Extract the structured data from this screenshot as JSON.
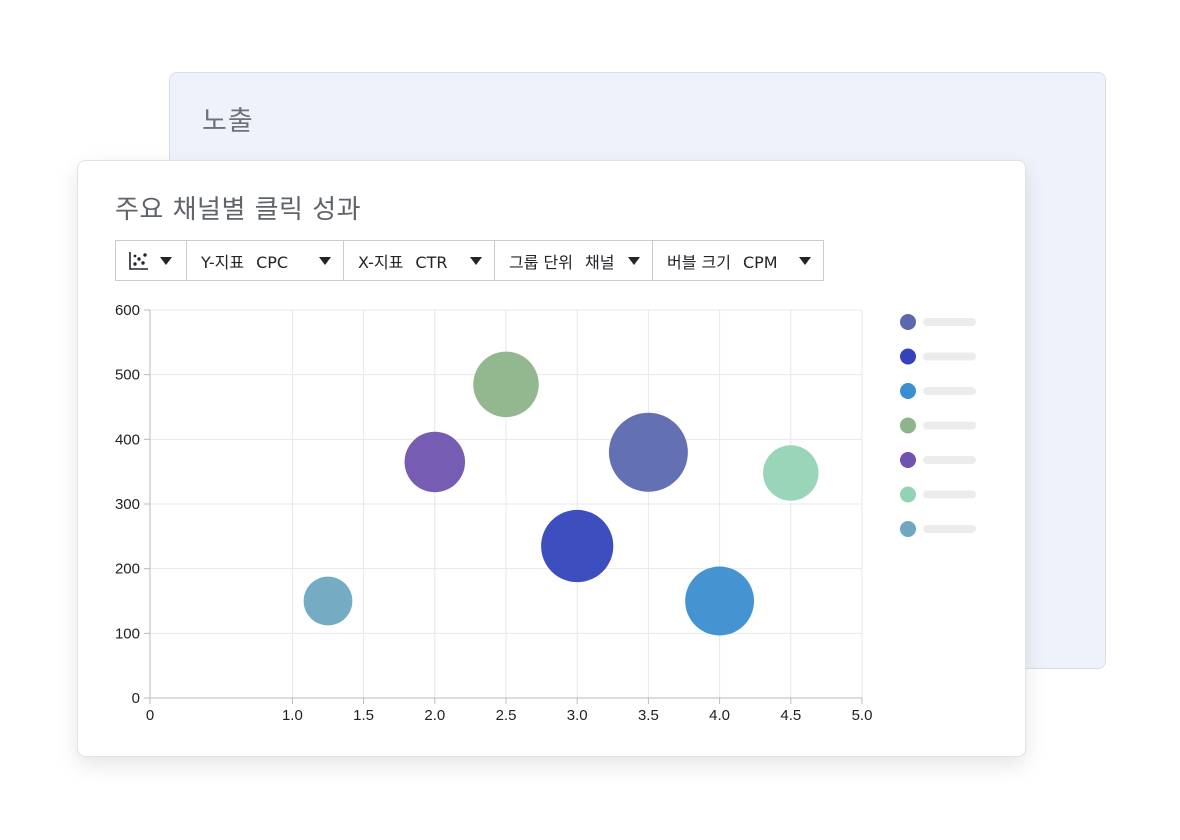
{
  "back_card": {
    "title": "노출"
  },
  "front_card": {
    "title": "주요 채널별 클릭 성과"
  },
  "toolbar": {
    "chart_type_icon": "scatter-chart-icon",
    "y_metric": {
      "label": "Y-지표",
      "value": "CPC"
    },
    "x_metric": {
      "label": "X-지표",
      "value": "CTR"
    },
    "group_unit": {
      "label": "그룹 단위",
      "value": "채널"
    },
    "bubble_size": {
      "label": "버블 크기",
      "value": "CPM"
    }
  },
  "chart_data": {
    "type": "scatter",
    "title": "",
    "xlabel": "",
    "ylabel": "",
    "xlim": [
      0,
      5.0
    ],
    "ylim": [
      0,
      600
    ],
    "x_ticks": [
      "0",
      "1.0",
      "1.5",
      "2.0",
      "2.5",
      "3.0",
      "3.5",
      "4.0",
      "4.5",
      "5.0"
    ],
    "y_ticks": [
      "0",
      "100",
      "200",
      "300",
      "400",
      "500",
      "600"
    ],
    "grid": true,
    "legend_position": "right",
    "series": [
      {
        "color": "#5b68b0",
        "points": [
          {
            "x": 3.5,
            "y": 380,
            "size": 47
          }
        ]
      },
      {
        "color": "#3344bb",
        "points": [
          {
            "x": 3.0,
            "y": 235,
            "size": 43
          }
        ]
      },
      {
        "color": "#3b8ecf",
        "points": [
          {
            "x": 4.0,
            "y": 150,
            "size": 41
          }
        ]
      },
      {
        "color": "#8db48a",
        "points": [
          {
            "x": 2.5,
            "y": 485,
            "size": 39
          }
        ]
      },
      {
        "color": "#7053b0",
        "points": [
          {
            "x": 2.0,
            "y": 365,
            "size": 36
          }
        ]
      },
      {
        "color": "#93d3b4",
        "points": [
          {
            "x": 4.5,
            "y": 348,
            "size": 33
          }
        ]
      },
      {
        "color": "#6fa7c1",
        "points": [
          {
            "x": 1.25,
            "y": 150,
            "size": 29
          }
        ]
      }
    ]
  }
}
